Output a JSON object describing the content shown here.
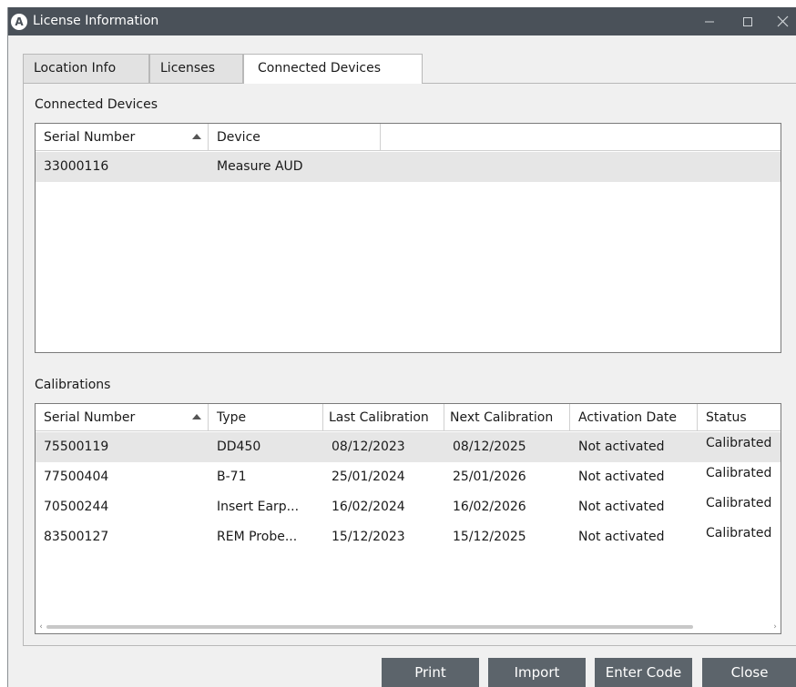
{
  "window": {
    "title": "License Information",
    "app_icon_letter": "A",
    "minimize_icon": "minimize-icon",
    "maximize_icon": "maximize-icon",
    "close_icon": "close-icon"
  },
  "tabs": [
    {
      "label": "Location Info",
      "active": false
    },
    {
      "label": "Licenses",
      "active": false
    },
    {
      "label": "Connected Devices",
      "active": true
    }
  ],
  "connected_devices": {
    "section_label": "Connected Devices",
    "columns": [
      "Serial Number",
      "Device"
    ],
    "sort_column": "Serial Number",
    "rows": [
      {
        "serial": "33000116",
        "device": "Measure AUD",
        "selected": true
      }
    ]
  },
  "calibrations": {
    "section_label": "Calibrations",
    "columns": [
      "Serial Number",
      "Type",
      "Last Calibration",
      "Next Calibration",
      "Activation Date",
      "Status"
    ],
    "sort_column": "Serial Number",
    "rows": [
      {
        "serial": "75500119",
        "type": "DD450",
        "last": "08/12/2023",
        "next": "08/12/2025",
        "activation": "Not activated",
        "status": "Calibrated",
        "selected": true
      },
      {
        "serial": "77500404",
        "type": "B-71",
        "last": "25/01/2024",
        "next": "25/01/2026",
        "activation": "Not activated",
        "status": "Calibrated",
        "selected": false
      },
      {
        "serial": "70500244",
        "type": "Insert Earp...",
        "last": "16/02/2024",
        "next": "16/02/2026",
        "activation": "Not activated",
        "status": "Calibrated",
        "selected": false
      },
      {
        "serial": "83500127",
        "type": "REM Probe...",
        "last": "15/12/2023",
        "next": "15/12/2025",
        "activation": "Not activated",
        "status": "Calibrated",
        "selected": false
      }
    ]
  },
  "buttons": {
    "print": "Print",
    "import": "Import",
    "enter_code": "Enter Code",
    "close": "Close"
  },
  "colors": {
    "titlebar": "#4a5159",
    "button": "#5c646b",
    "selected_row": "#e6e6e6"
  }
}
